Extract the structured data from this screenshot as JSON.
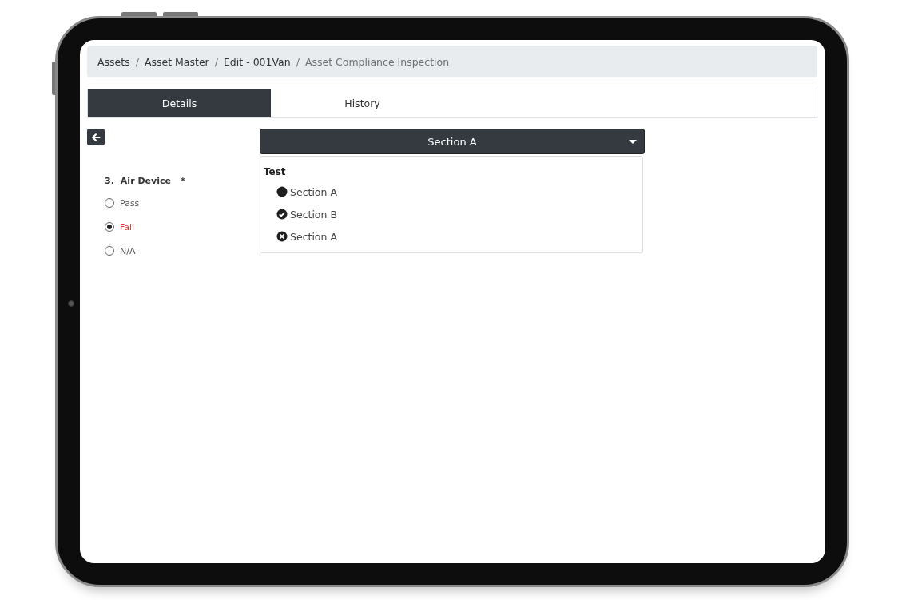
{
  "breadcrumb": [
    {
      "label": "Assets",
      "current": false,
      "separator": "/"
    },
    {
      "label": "Asset Master",
      "current": false,
      "separator": "/"
    },
    {
      "label": "Edit - 001Van",
      "current": false,
      "separator": "/"
    },
    {
      "label": "Asset Compliance Inspection",
      "current": true
    }
  ],
  "tabs": [
    {
      "label": "Details",
      "selected": true
    },
    {
      "label": "History",
      "selected": false
    }
  ],
  "question": {
    "number": "3.",
    "label": "Air Device",
    "required_mark": "*",
    "options": [
      {
        "label": "Pass",
        "kind": "pass",
        "selected": false
      },
      {
        "label": "Fail",
        "kind": "fail",
        "selected": true
      },
      {
        "label": "N/A",
        "kind": "na",
        "selected": false
      }
    ]
  },
  "section_dropdown": {
    "value": "Section A",
    "expanded": true,
    "group": "Test",
    "items": [
      {
        "label": "Section A",
        "kind": "dot"
      },
      {
        "label": "Section B",
        "kind": "check"
      },
      {
        "label": "Section A",
        "kind": "cross"
      }
    ]
  }
}
